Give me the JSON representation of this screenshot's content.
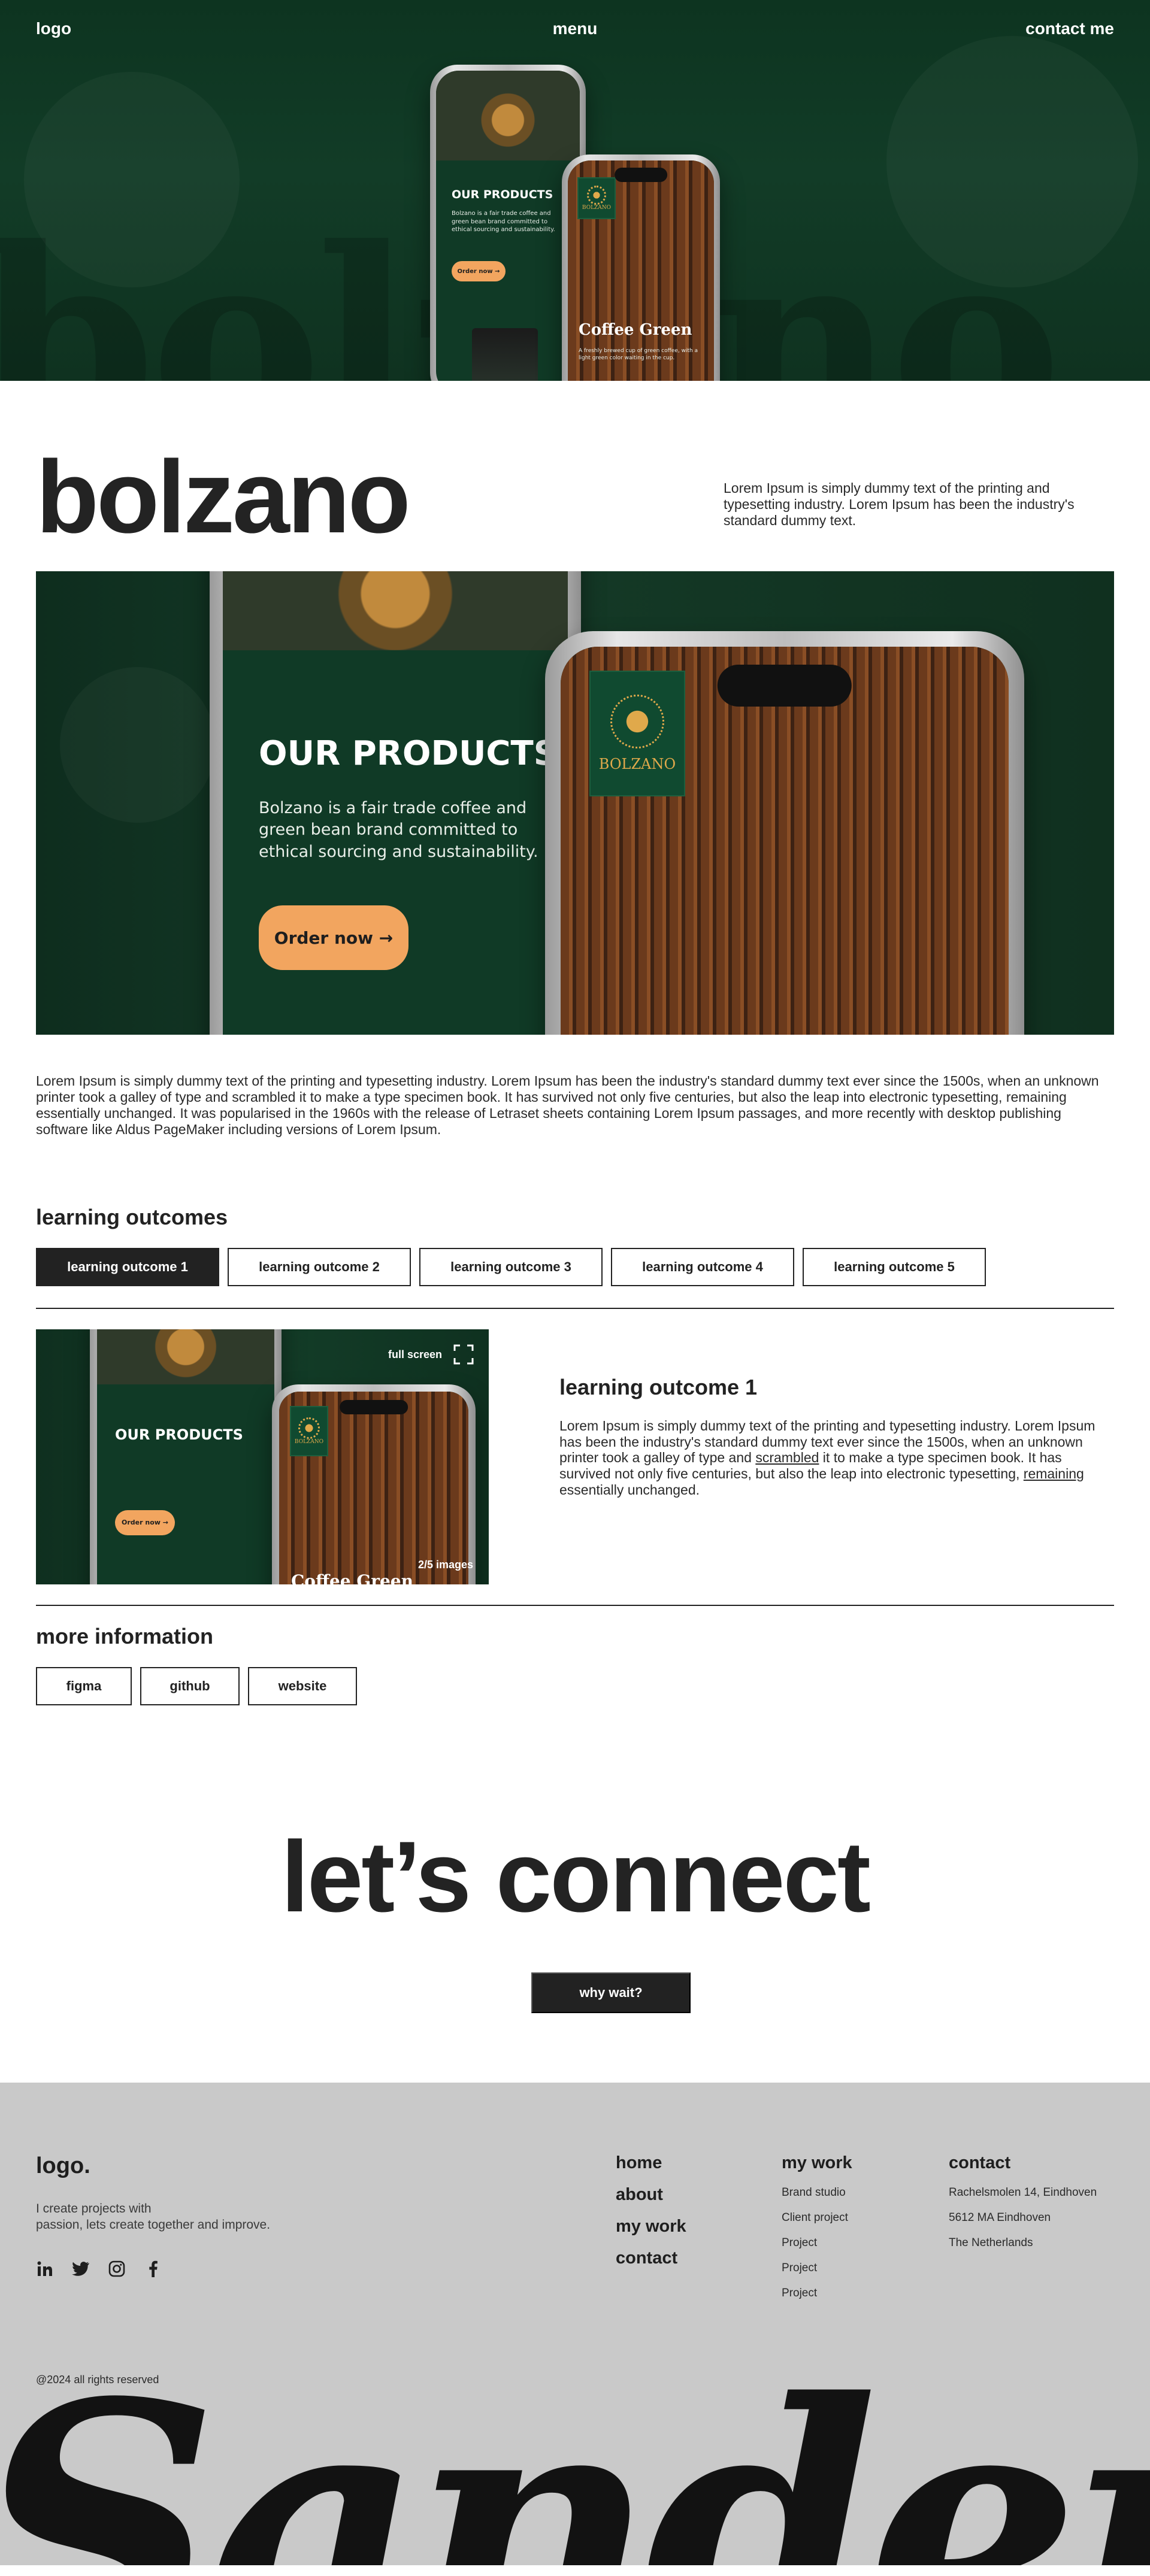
{
  "nav": {
    "logo": "logo",
    "menu": "menu",
    "contact": "contact me"
  },
  "hero": {
    "background_text": "bolzano",
    "phone_left": {
      "heading": "OUR PRODUCTS",
      "body": "Bolzano is a fair trade coffee and green bean brand committed to ethical sourcing and sustainability.",
      "cta": "Order now"
    },
    "phone_right": {
      "brand": "BOLZANO",
      "title": "Coffee Green",
      "body": "A freshly brewed cup of green coffee, with a light green color waiting in the cup."
    }
  },
  "project": {
    "title": "bolzano",
    "intro": "Lorem Ipsum is simply dummy text of the printing and typesetting industry. Lorem Ipsum has been the industry's standard dummy text.",
    "image": {
      "heading": "OUR PRODUCTS",
      "body": "Bolzano is a fair trade coffee and green bean brand committed to ethical sourcing and sustainability.",
      "cta": "Order now",
      "brand": "BOLZANO"
    },
    "body": "Lorem Ipsum is simply dummy text of the printing and typesetting industry. Lorem Ipsum has been the industry's standard dummy text ever since the 1500s, when an unknown printer took a galley of type and scrambled it to make a type specimen book. It has survived not only five centuries, but also the leap into electronic typesetting, remaining essentially unchanged. It was popularised in the 1960s with the release of Letraset sheets containing Lorem Ipsum passages, and more recently with desktop publishing software like Aldus PageMaker including versions of Lorem Ipsum."
  },
  "learning_outcomes": {
    "heading": "learning outcomes",
    "tabs": [
      "learning outcome 1",
      "learning outcome 2",
      "learning outcome 3",
      "learning outcome 4",
      "learning outcome 5"
    ],
    "active_index": 0,
    "gallery": {
      "full_screen": "full screen",
      "count": "2/5 images",
      "heading": "OUR PRODUCTS",
      "cta": "Order now",
      "brand": "BOLZANO",
      "coffee": "Coffee Green"
    },
    "detail": {
      "title": "learning outcome 1",
      "text_a": "Lorem Ipsum is simply dummy text of the printing and typesetting industry. Lorem Ipsum has been the industry's standard dummy text ever since the 1500s, when an unknown printer took a galley of type and ",
      "link_a": "scrambled",
      "text_b": " it to make a type specimen book. It has survived not only five centuries, but also the leap into electronic typesetting, ",
      "link_b": "remaining",
      "text_c": " essentially unchanged."
    }
  },
  "more_information": {
    "heading": "more information",
    "buttons": [
      "figma",
      "github",
      "website"
    ]
  },
  "connect": {
    "title": "let’s connect",
    "button": "why wait?"
  },
  "footer": {
    "logo": "logo.",
    "tagline_1": "I create projects with",
    "tagline_2": "passion, lets create together and improve.",
    "social": [
      "linkedin-icon",
      "twitter-icon",
      "instagram-icon",
      "facebook-icon"
    ],
    "nav": [
      "home",
      "about",
      "my work",
      "contact"
    ],
    "my_work": {
      "heading": "my work",
      "items": [
        "Brand studio",
        "Client project",
        "Project",
        "Project",
        "Project"
      ]
    },
    "contact": {
      "heading": "contact",
      "lines": [
        "Rachelsmolen 14, Eindhoven",
        "5612 MA Eindhoven",
        "The Netherlands"
      ]
    },
    "copyright": "@2024 all rights reserved",
    "big_name": "Sander"
  },
  "colors": {
    "dark_green": "#123c27",
    "accent_orange": "#f2a55f",
    "ink": "#222222",
    "footer_bg": "#c9c9c9"
  }
}
